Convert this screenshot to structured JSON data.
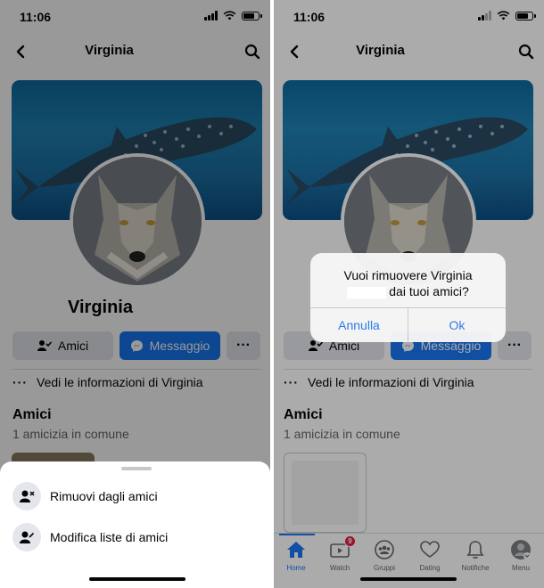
{
  "status_bar": {
    "time": "11:06"
  },
  "header": {
    "title": "Virginia"
  },
  "profile": {
    "name": "Virginia"
  },
  "actions": {
    "friends_label": "Amici",
    "message_label": "Messaggio",
    "more_label": "···"
  },
  "info": {
    "label": "Vedi le informazioni di Virginia",
    "dots": "···"
  },
  "friends_section": {
    "title": "Amici",
    "mutual": "1 amicizia in comune"
  },
  "sheet": {
    "items": [
      {
        "label": "Rimuovi dagli amici",
        "icon": "remove-friend-icon"
      },
      {
        "label": "Modifica liste di amici",
        "icon": "edit-friend-list-icon"
      }
    ]
  },
  "alert": {
    "line1": "Vuoi rimuovere Virginia",
    "line2": "dai tuoi amici?",
    "cancel": "Annulla",
    "ok": "Ok"
  },
  "tabbar": {
    "tabs": [
      {
        "label": "Home",
        "icon": "home-icon",
        "active": true
      },
      {
        "label": "Watch",
        "icon": "watch-icon",
        "badge": "9"
      },
      {
        "label": "Gruppi",
        "icon": "groups-icon"
      },
      {
        "label": "Dating",
        "icon": "dating-icon"
      },
      {
        "label": "Notifiche",
        "icon": "bell-icon"
      },
      {
        "label": "Menu",
        "icon": "menu-avatar-icon"
      }
    ]
  },
  "colors": {
    "accent": "#1877f2",
    "alert_button": "#2f7ae5",
    "badge": "#e41e3f",
    "secondary_button": "#e4e6eb"
  }
}
